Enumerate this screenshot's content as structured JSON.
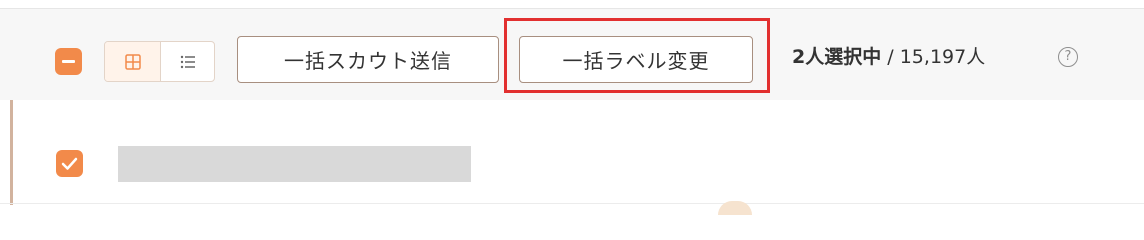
{
  "toolbar": {
    "bulk_scout_label": "一括スカウト送信",
    "bulk_label_change_label": "一括ラベル変更",
    "selected_text": "2人選択中",
    "total_text": "/ 15,197人",
    "help_glyph": "?"
  },
  "view_toggle": {
    "active": "grid"
  },
  "colors": {
    "accent": "#f28a4a",
    "highlight": "#e23030"
  }
}
